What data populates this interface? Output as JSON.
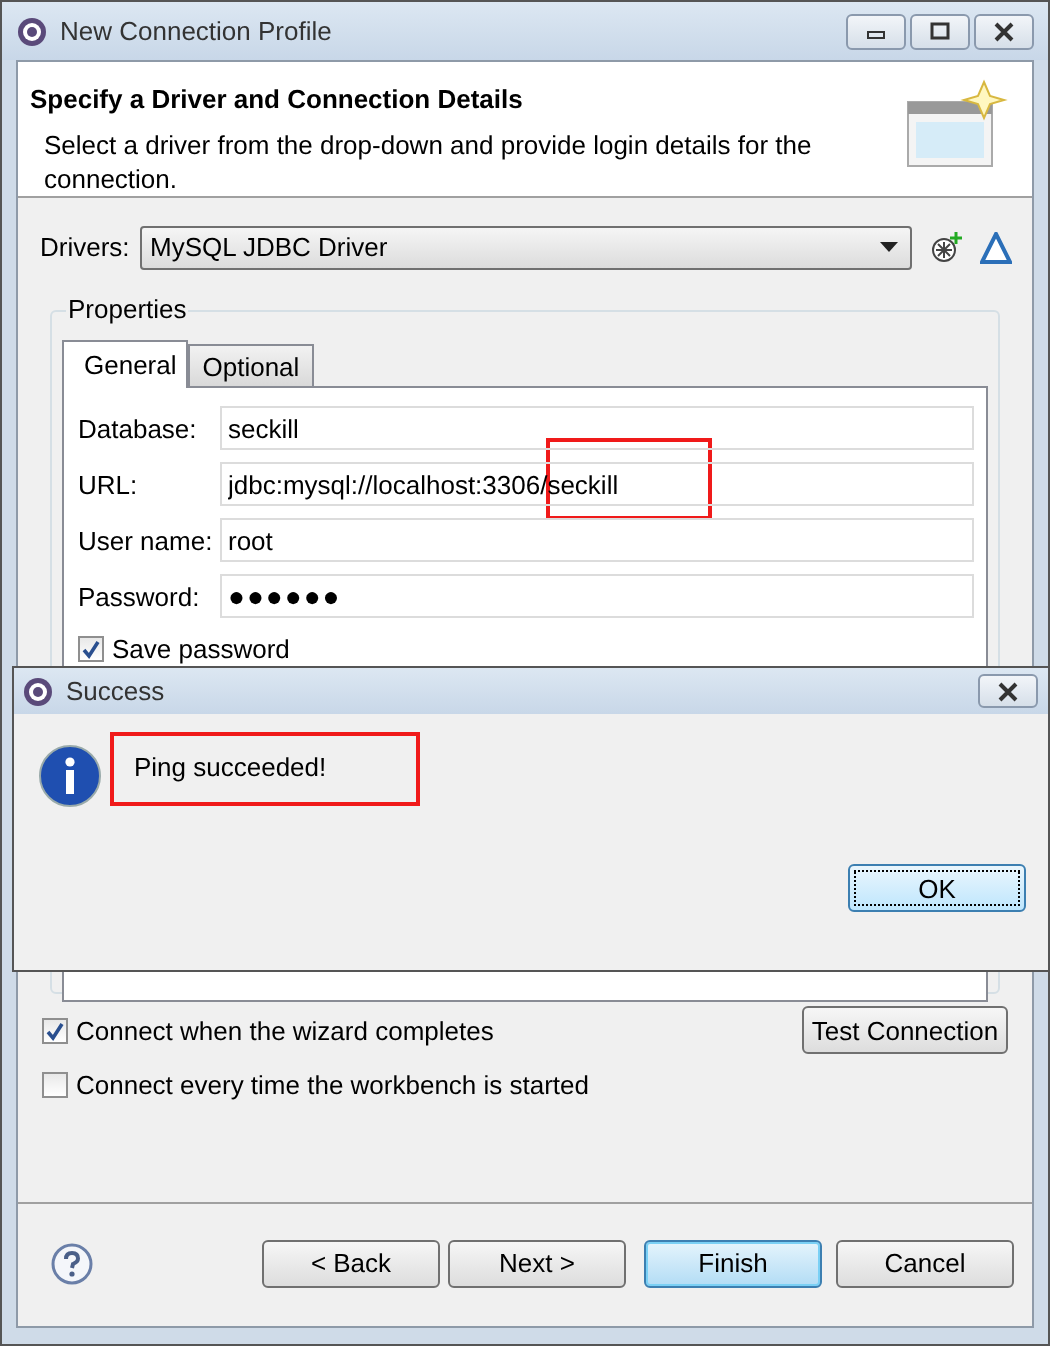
{
  "window": {
    "title": "New Connection Profile"
  },
  "header": {
    "title": "Specify a Driver and Connection Details",
    "description": "Select a driver from the drop-down and provide login details for the connection."
  },
  "drivers": {
    "label": "Drivers:",
    "value": "MySQL JDBC Driver"
  },
  "properties": {
    "title": "Properties",
    "tabs": [
      {
        "label": "General",
        "selected": true
      },
      {
        "label": "Optional",
        "selected": false
      }
    ],
    "fields": [
      {
        "label": "Database:",
        "value": "seckill",
        "kind": "text"
      },
      {
        "label": "URL:",
        "value": "jdbc:mysql://localhost:3306/seckill",
        "kind": "text"
      },
      {
        "label": "User name:",
        "value": "root",
        "kind": "text"
      },
      {
        "label": "Password:",
        "value": "●●●●●●",
        "kind": "password"
      }
    ],
    "save_password": {
      "label": "Save password",
      "checked": true
    }
  },
  "options": [
    {
      "label": "Connect when the wizard completes",
      "checked": true
    },
    {
      "label": "Connect every time the workbench is started",
      "checked": false
    }
  ],
  "test_button": "Test Connection",
  "buttons": [
    {
      "label": "< Back",
      "default": false
    },
    {
      "label": "Next >",
      "default": false
    },
    {
      "label": "Finish",
      "default": true
    },
    {
      "label": "Cancel",
      "default": false
    }
  ],
  "dialog": {
    "title": "Success",
    "message": "Ping succeeded!",
    "button": "OK"
  }
}
